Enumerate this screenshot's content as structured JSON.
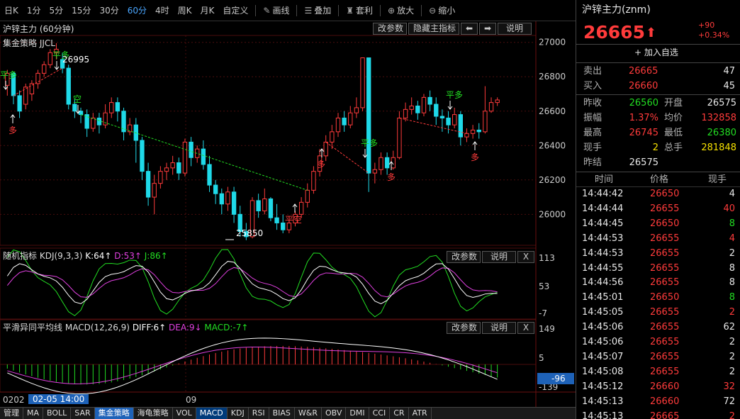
{
  "toolbar": {
    "periods": [
      "日K",
      "1分",
      "5分",
      "15分",
      "30分",
      "60分",
      "4时",
      "周K",
      "月K",
      "自定义"
    ],
    "active_period": "60分",
    "tools": [
      {
        "icon": "pencil-icon",
        "glyph": "✎",
        "label": "画线"
      },
      {
        "icon": "layers-icon",
        "glyph": "☰",
        "label": "叠加"
      },
      {
        "icon": "bag-icon",
        "glyph": "♜",
        "label": "套利"
      },
      {
        "icon": "zoom-in-icon",
        "glyph": "⊕",
        "label": "放大"
      },
      {
        "icon": "zoom-out-icon",
        "glyph": "⊖",
        "label": "缩小"
      }
    ],
    "arrow": "›"
  },
  "main_panel": {
    "title": "沪锌主力 (60分钟)",
    "strategy": "集金策略 JJCL",
    "buttons": [
      "改参数",
      "隐藏主指标",
      "⬅",
      "➡",
      "说明"
    ],
    "y_ticks": [
      "27000",
      "26800",
      "26600",
      "26400",
      "26200",
      "26000"
    ],
    "annotations": {
      "high": "26995",
      "low": "25850",
      "ping_duo": "平多",
      "kong": "空",
      "duo": "多",
      "ping_kong": "平空"
    }
  },
  "kdj_panel": {
    "name": "随机指标",
    "params": "KDJ(9,3,3)",
    "k": "K:64↑",
    "d": "D:53↑",
    "j": "J:86↑",
    "buttons": [
      "改参数",
      "说明",
      "X"
    ],
    "y_ticks": [
      "113",
      "53",
      "-7"
    ]
  },
  "macd_panel": {
    "name": "平滑异同平均线",
    "params": "MACD(12,26,9)",
    "diff": "DIFF:6↑",
    "dea": "DEA:9↓",
    "macd": "MACD:-7↑",
    "buttons": [
      "改参数",
      "说明",
      "X"
    ],
    "y_ticks": [
      "149",
      "5",
      "-139"
    ],
    "cursor_value": "-96"
  },
  "time_axis": {
    "start": "0202",
    "cursor": "02-05 14:00",
    "mid": "09"
  },
  "bottom_tabs": [
    "管理",
    "MA",
    "BOLL",
    "SAR",
    "集金策略",
    "海龟策略",
    "VOL",
    "MACD",
    "KDJ",
    "RSI",
    "BIAS",
    "W&R",
    "OBV",
    "DMI",
    "CCI",
    "CR",
    "ATR"
  ],
  "bottom_active": "集金策略",
  "bottom_selected": "MACD",
  "quote": {
    "name": "沪锌主力(znm)",
    "price": "26665",
    "arrow": "⬆",
    "change": "+90",
    "change_pct": "+0.34%",
    "add_watch": "+ 加入自选",
    "sell": {
      "label": "卖出",
      "price": "26665",
      "vol": "47"
    },
    "buy": {
      "label": "买入",
      "price": "26660",
      "vol": "45"
    },
    "stats": [
      {
        "l1": "昨收",
        "v1": "26560",
        "c1": "green",
        "l2": "开盘",
        "v2": "26575",
        "c2": "white"
      },
      {
        "l1": "振幅",
        "v1": "1.37%",
        "c1": "red",
        "l2": "均价",
        "v2": "132858",
        "c2": "red"
      },
      {
        "l1": "最高",
        "v1": "26745",
        "c1": "red",
        "l2": "最低",
        "v2": "26380",
        "c2": "green"
      },
      {
        "l1": "现手",
        "v1": "2",
        "c1": "yellow",
        "l2": "总手",
        "v2": "281848",
        "c2": "yellow"
      },
      {
        "l1": "昨结",
        "v1": "26575",
        "c1": "white",
        "l2": "",
        "v2": "",
        "c2": "white"
      }
    ],
    "tick_headers": [
      "时间",
      "价格",
      "现手"
    ],
    "ticks": [
      {
        "t": "14:44:42",
        "p": "26650",
        "v": "4",
        "vc": "white"
      },
      {
        "t": "14:44:44",
        "p": "26655",
        "v": "40",
        "vc": "red"
      },
      {
        "t": "14:44:45",
        "p": "26650",
        "v": "8",
        "vc": "green"
      },
      {
        "t": "14:44:53",
        "p": "26655",
        "v": "4",
        "vc": "red"
      },
      {
        "t": "14:44:53",
        "p": "26655",
        "v": "2",
        "vc": "white"
      },
      {
        "t": "14:44:55",
        "p": "26655",
        "v": "8",
        "vc": "white"
      },
      {
        "t": "14:44:56",
        "p": "26655",
        "v": "8",
        "vc": "white"
      },
      {
        "t": "14:45:01",
        "p": "26650",
        "v": "8",
        "vc": "green"
      },
      {
        "t": "14:45:05",
        "p": "26655",
        "v": "2",
        "vc": "red"
      },
      {
        "t": "14:45:06",
        "p": "26655",
        "v": "62",
        "vc": "white"
      },
      {
        "t": "14:45:06",
        "p": "26655",
        "v": "2",
        "vc": "white"
      },
      {
        "t": "14:45:07",
        "p": "26655",
        "v": "2",
        "vc": "white"
      },
      {
        "t": "14:45:08",
        "p": "26655",
        "v": "2",
        "vc": "white"
      },
      {
        "t": "14:45:12",
        "p": "26660",
        "v": "32",
        "vc": "red"
      },
      {
        "t": "14:45:13",
        "p": "26660",
        "v": "72",
        "vc": "white"
      },
      {
        "t": "14:45:13",
        "p": "26665",
        "v": "2",
        "vc": "red"
      }
    ]
  },
  "chart_data": {
    "type": "candlestick",
    "title": "沪锌主力 (60分钟)",
    "ylim": [
      25820,
      27040
    ],
    "y_ticks": [
      26000,
      26200,
      26400,
      26600,
      26800,
      27000
    ],
    "candles": [
      [
        26750,
        26820,
        26840,
        26690
      ],
      [
        26820,
        26690,
        26830,
        26640
      ],
      [
        26690,
        26600,
        26720,
        26560
      ],
      [
        26640,
        26740,
        26760,
        26610
      ],
      [
        26700,
        26760,
        26780,
        26660
      ],
      [
        26760,
        26820,
        26840,
        26730
      ],
      [
        26820,
        26870,
        26890,
        26800
      ],
      [
        26870,
        26940,
        26960,
        26850
      ],
      [
        26940,
        26960,
        26995,
        26900
      ],
      [
        26900,
        26850,
        26940,
        26820
      ],
      [
        26850,
        26640,
        26870,
        26610
      ],
      [
        26640,
        26600,
        26670,
        26560
      ],
      [
        26600,
        26580,
        26620,
        26530
      ],
      [
        26580,
        26500,
        26610,
        26450
      ],
      [
        26500,
        26560,
        26590,
        26480
      ],
      [
        26560,
        26520,
        26590,
        26470
      ],
      [
        26520,
        26590,
        26640,
        26500
      ],
      [
        26590,
        26650,
        26680,
        26560
      ],
      [
        26650,
        26600,
        26680,
        26540
      ],
      [
        26600,
        26480,
        26620,
        26430
      ],
      [
        26480,
        26520,
        26560,
        26460
      ],
      [
        26520,
        26430,
        26560,
        26300
      ],
      [
        26430,
        26250,
        26450,
        26200
      ],
      [
        26250,
        26100,
        26300,
        26050
      ],
      [
        26100,
        26180,
        26230,
        26000
      ],
      [
        26180,
        26250,
        26280,
        26150
      ],
      [
        26250,
        26270,
        26300,
        26200
      ],
      [
        26270,
        26300,
        26340,
        26230
      ],
      [
        26300,
        26240,
        26330,
        26200
      ],
      [
        26240,
        26420,
        26440,
        26220
      ],
      [
        26420,
        26330,
        26450,
        26280
      ],
      [
        26330,
        26380,
        26400,
        26300
      ],
      [
        26380,
        26290,
        26430,
        26260
      ],
      [
        26290,
        26170,
        26340,
        26130
      ],
      [
        26170,
        26120,
        26200,
        26060
      ],
      [
        26120,
        26060,
        26150,
        26000
      ],
      [
        26060,
        26130,
        26160,
        26020
      ],
      [
        26130,
        26000,
        26160,
        25950
      ],
      [
        26000,
        25900,
        26050,
        25870
      ],
      [
        25900,
        25870,
        25950,
        25850
      ],
      [
        25870,
        26080,
        26100,
        25860
      ],
      [
        26080,
        26020,
        26120,
        25980
      ],
      [
        26020,
        26090,
        26150,
        26000
      ],
      [
        26090,
        25980,
        26100,
        25960
      ],
      [
        25980,
        25950,
        26060,
        25910
      ],
      [
        25950,
        25910,
        26000,
        25890
      ],
      [
        25910,
        25950,
        25990,
        25890
      ],
      [
        25950,
        26000,
        26020,
        25930
      ],
      [
        26000,
        26070,
        26100,
        25980
      ],
      [
        26070,
        26140,
        26180,
        26040
      ],
      [
        26140,
        26250,
        26280,
        26120
      ],
      [
        26250,
        26340,
        26380,
        26220
      ],
      [
        26340,
        26420,
        26460,
        26310
      ],
      [
        26420,
        26480,
        26520,
        26380
      ],
      [
        26480,
        26560,
        26590,
        26450
      ],
      [
        26560,
        26520,
        26600,
        26480
      ],
      [
        26520,
        26590,
        26630,
        26500
      ],
      [
        26590,
        26620,
        26680,
        26560
      ],
      [
        26620,
        26910,
        26910,
        26600
      ],
      [
        26910,
        26240,
        26910,
        26130
      ],
      [
        26240,
        26260,
        26300,
        26180
      ],
      [
        26260,
        26330,
        26360,
        26230
      ],
      [
        26330,
        26270,
        26360,
        26230
      ],
      [
        26270,
        26330,
        26370,
        26260
      ],
      [
        26330,
        26560,
        26600,
        26320
      ],
      [
        26560,
        26610,
        26650,
        26540
      ],
      [
        26610,
        26630,
        26680,
        26580
      ],
      [
        26630,
        26590,
        26660,
        26550
      ],
      [
        26590,
        26680,
        26700,
        26570
      ],
      [
        26680,
        26640,
        26720,
        26600
      ],
      [
        26640,
        26570,
        26680,
        26520
      ],
      [
        26570,
        26560,
        26610,
        26480
      ],
      [
        26560,
        26520,
        26600,
        26470
      ],
      [
        26520,
        26580,
        26620,
        26500
      ],
      [
        26580,
        26450,
        26600,
        26400
      ],
      [
        26450,
        26470,
        26500,
        26420
      ],
      [
        26470,
        26490,
        26520,
        26440
      ],
      [
        26490,
        26480,
        26530,
        26440
      ],
      [
        26480,
        26600,
        26745,
        26470
      ],
      [
        26600,
        26650,
        26680,
        26590
      ],
      [
        26650,
        26665,
        26680,
        26630
      ]
    ]
  },
  "colors": {
    "up": "#ff3b3b",
    "down": "#1fd9e8",
    "k_line": "#ffffff",
    "d_line": "#e040e0",
    "j_line": "#22dd22",
    "grid": "#3a0a0a",
    "accent": "#1e62b8"
  }
}
